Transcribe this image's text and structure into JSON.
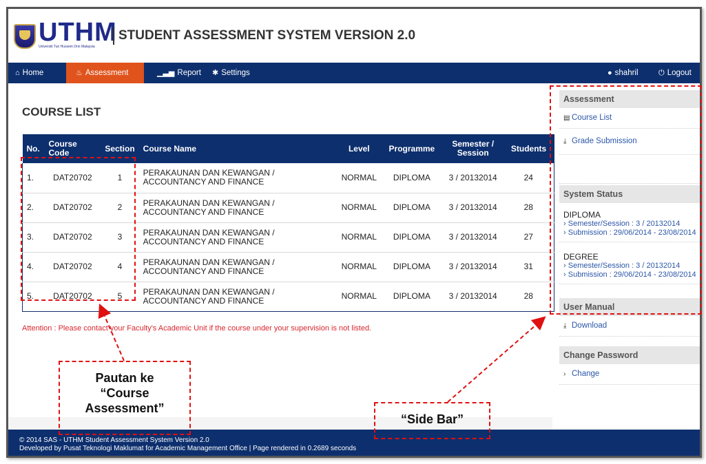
{
  "header": {
    "logo_text": "UTHM",
    "logo_sub": "Universiti Tun Hussein Onn Malaysia",
    "app_title": "STUDENT ASSESSMENT SYSTEM VERSION 2.0"
  },
  "nav": {
    "home": "Home",
    "assessment": "Assessment",
    "report": "Report",
    "settings": "Settings",
    "user": "shahril",
    "logout": "Logout"
  },
  "main": {
    "title": "COURSE LIST",
    "columns": [
      "No.",
      "Course Code",
      "Section",
      "Course Name",
      "Level",
      "Programme",
      "Semester / Session",
      "Students"
    ],
    "rows": [
      {
        "no": "1.",
        "code": "DAT20702",
        "section": "1",
        "name": "PERAKAUNAN DAN KEWANGAN / ACCOUNTANCY AND FINANCE",
        "level": "NORMAL",
        "programme": "DIPLOMA",
        "session": "3 / 20132014",
        "students": "24"
      },
      {
        "no": "2.",
        "code": "DAT20702",
        "section": "2",
        "name": "PERAKAUNAN DAN KEWANGAN / ACCOUNTANCY AND FINANCE",
        "level": "NORMAL",
        "programme": "DIPLOMA",
        "session": "3 / 20132014",
        "students": "28"
      },
      {
        "no": "3.",
        "code": "DAT20702",
        "section": "3",
        "name": "PERAKAUNAN DAN KEWANGAN / ACCOUNTANCY AND FINANCE",
        "level": "NORMAL",
        "programme": "DIPLOMA",
        "session": "3 / 20132014",
        "students": "27"
      },
      {
        "no": "4.",
        "code": "DAT20702",
        "section": "4",
        "name": "PERAKAUNAN DAN KEWANGAN / ACCOUNTANCY AND FINANCE",
        "level": "NORMAL",
        "programme": "DIPLOMA",
        "session": "3 / 20132014",
        "students": "31"
      },
      {
        "no": "5.",
        "code": "DAT20702",
        "section": "5",
        "name": "PERAKAUNAN DAN KEWANGAN / ACCOUNTANCY AND FINANCE",
        "level": "NORMAL",
        "programme": "DIPLOMA",
        "session": "3 / 20132014",
        "students": "28"
      }
    ],
    "attention": "Attention : Please contact your Faculty's Academic Unit if the course under your supervision is not listed."
  },
  "sidebar": {
    "assessment_head": "Assessment",
    "course_list": "Course List",
    "grade_submission": "Grade Submission",
    "system_status_head": "System Status",
    "diploma": {
      "label": "DIPLOMA",
      "semester": "Semester/Session : 3 / 20132014",
      "submission": "Submission : 29/06/2014 - 23/08/2014"
    },
    "degree": {
      "label": "DEGREE",
      "semester": "Semester/Session : 3 / 20132014",
      "submission": "Submission : 29/06/2014 - 23/08/2014"
    },
    "user_manual_head": "User Manual",
    "download": "Download",
    "change_password_head": "Change Password",
    "change": "Change"
  },
  "footer": {
    "line1": "© 2014 SAS - UTHM Student Assessment System Version 2.0",
    "line2": "Developed by Pusat Teknologi Maklumat for Academic Management Office | Page rendered in 0.2689 seconds"
  },
  "annotations": {
    "course_link_label_1": "Pautan ke",
    "course_link_label_2": "“Course",
    "course_link_label_3": "Assessment”",
    "side_bar_label": "“Side Bar”"
  },
  "colors": {
    "navy": "#0d2f6e",
    "active_tab": "#e0531c",
    "link": "#2b56a8",
    "attention": "#d8262e",
    "annotation": "#e01010"
  }
}
